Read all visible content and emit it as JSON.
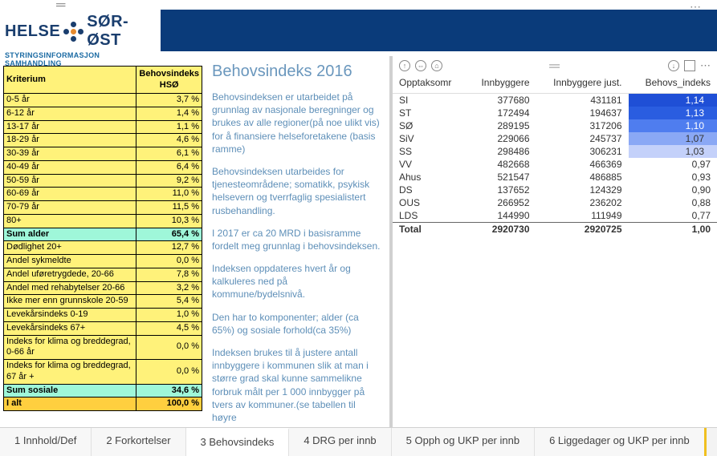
{
  "header": {
    "brand_left": "HELSE",
    "brand_right": "SØR-ØST",
    "subtitle": "STYRINGSINFORMASJON SAMHANDLING"
  },
  "left_table": {
    "head_kriterium": "Kriterium",
    "head_indeks": "Behovsindeks HSØ",
    "rows": [
      {
        "label": "0-5 år",
        "val": "3,7 %"
      },
      {
        "label": "6-12 år",
        "val": "1,4 %"
      },
      {
        "label": "13-17 år",
        "val": "1,1 %"
      },
      {
        "label": "18-29 år",
        "val": "4,6 %"
      },
      {
        "label": "30-39 år",
        "val": "6,1 %"
      },
      {
        "label": "40-49 år",
        "val": "6,4 %"
      },
      {
        "label": "50-59 år",
        "val": "9,2 %"
      },
      {
        "label": "60-69 år",
        "val": "11,0 %"
      },
      {
        "label": "70-79 år",
        "val": "11,5 %"
      },
      {
        "label": "80+",
        "val": "10,3 %"
      }
    ],
    "sum_alder": {
      "label": "Sum alder",
      "val": "65,4 %"
    },
    "rows2": [
      {
        "label": "Dødlighet 20+",
        "val": "12,7 %"
      },
      {
        "label": "Andel sykmeldte",
        "val": "0,0 %"
      },
      {
        "label": "Andel uføretrygdede, 20-66",
        "val": "7,8 %"
      },
      {
        "label": "Andel med rehabytelser 20-66",
        "val": "3,2 %"
      },
      {
        "label": "Ikke mer enn grunnskole 20-59",
        "val": "5,4 %"
      },
      {
        "label": "Levekårsindeks 0-19",
        "val": "1,0 %"
      },
      {
        "label": "Levekårsindeks 67+",
        "val": "4,5 %"
      },
      {
        "label": "Indeks for klima og breddegrad, 0-66 år",
        "val": "0,0 %"
      },
      {
        "label": "Indeks for klima og breddegrad, 67 år +",
        "val": "0,0 %"
      }
    ],
    "sum_sosiale": {
      "label": "Sum sosiale",
      "val": "34,6 %"
    },
    "i_alt": {
      "label": "I alt",
      "val": "100,0 %"
    }
  },
  "mid": {
    "title": "Behovsindeks 2016",
    "p1": "Behovsindeksen er utarbeidet på grunnlag av nasjonale beregninger og brukes av alle regioner(på noe ulikt vis) for å finansiere helseforetakene (basis ramme)",
    "p2": "Behovsindeksen utarbeides for tjenesteområdene; somatikk, psykisk helsevern og tverrfaglig spesialistert rusbehandling.",
    "p3": "I 2017 er ca 20 MRD i basisramme fordelt meg grunnlag i behovsindeksen.",
    "p4": "Indeksen oppdateres hvert år og kalkuleres ned på kommune/bydelsnivå.",
    "p5": "Den har to komponenter; alder (ca 65%) og sosiale forhold(ca 35%)",
    "p6": "Indeksen brukes til å justere antall innbyggere i kommunen slik at man i større grad skal kunne sammelikne forbruk målt per 1 000 innbygger på tvers av kommuner.(se tabellen til høyre"
  },
  "right_table": {
    "headers": {
      "opptak": "Opptaksomr",
      "innb": "Innbyggere",
      "just": "Innbyggere just.",
      "idx": "Behovs_indeks"
    },
    "rows": [
      {
        "o": "SI",
        "i": "377680",
        "j": "431181",
        "x": "1,14",
        "bg": "#1f4fd6",
        "fg": "#fff"
      },
      {
        "o": "ST",
        "i": "172494",
        "j": "194637",
        "x": "1,13",
        "bg": "#2a5de0",
        "fg": "#fff"
      },
      {
        "o": "SØ",
        "i": "289195",
        "j": "317206",
        "x": "1,10",
        "bg": "#4f7def",
        "fg": "#fff"
      },
      {
        "o": "SiV",
        "i": "229066",
        "j": "245737",
        "x": "1,07",
        "bg": "#8aa8f5",
        "fg": "#333"
      },
      {
        "o": "SS",
        "i": "298486",
        "j": "306231",
        "x": "1,03",
        "bg": "#c4d1fa",
        "fg": "#333"
      },
      {
        "o": "VV",
        "i": "482668",
        "j": "466369",
        "x": "0,97",
        "bg": "",
        "fg": "#333"
      },
      {
        "o": "Ahus",
        "i": "521547",
        "j": "486885",
        "x": "0,93",
        "bg": "",
        "fg": "#333"
      },
      {
        "o": "DS",
        "i": "137652",
        "j": "124329",
        "x": "0,90",
        "bg": "",
        "fg": "#333"
      },
      {
        "o": "OUS",
        "i": "266952",
        "j": "236202",
        "x": "0,88",
        "bg": "",
        "fg": "#333"
      },
      {
        "o": "LDS",
        "i": "144990",
        "j": "111949",
        "x": "0,77",
        "bg": "",
        "fg": "#333"
      }
    ],
    "total": {
      "o": "Total",
      "i": "2920730",
      "j": "2920725",
      "x": "1,00"
    }
  },
  "tabs": [
    {
      "label": "1 Innhold/Def",
      "active": false
    },
    {
      "label": "2 Forkortelser",
      "active": false
    },
    {
      "label": "3 Behovsindeks",
      "active": true
    },
    {
      "label": "4 DRG per innb",
      "active": false
    },
    {
      "label": "5 Opph og UKP per innb",
      "active": false
    },
    {
      "label": "6 Liggedager og UKP per innb",
      "active": false
    }
  ]
}
